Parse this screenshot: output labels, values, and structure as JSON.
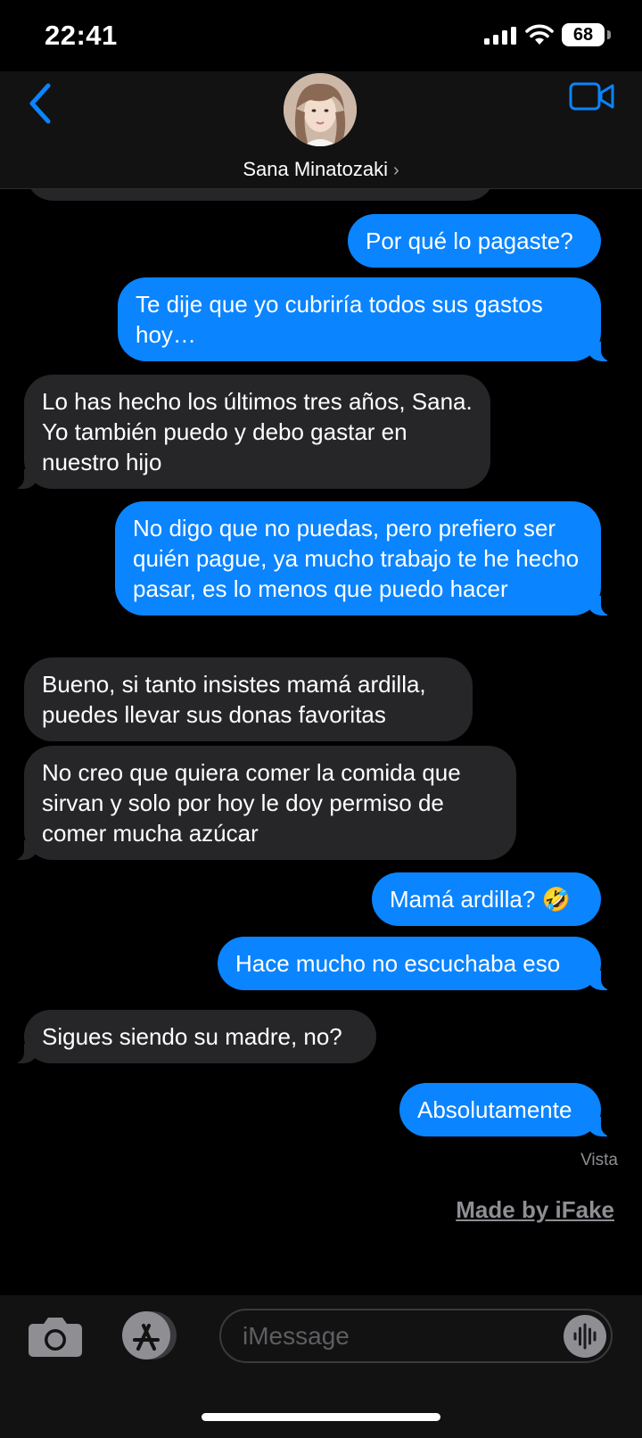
{
  "status_bar": {
    "time": "22:41",
    "battery": "68"
  },
  "header": {
    "contact_name": "Sana Minatozaki"
  },
  "messages": [
    {
      "dir": "out",
      "text": "Por qué lo pagaste?"
    },
    {
      "dir": "out",
      "text": "Te dije que yo cubriría todos sus gastos hoy…"
    },
    {
      "dir": "in",
      "text": "Lo has hecho los últimos tres años, Sana. Yo también puedo y debo gastar en nuestro hijo"
    },
    {
      "dir": "out",
      "text": "No digo que no puedas, pero prefiero ser quién pague, ya mucho trabajo te he hecho pasar, es lo menos que puedo hacer"
    },
    {
      "dir": "in",
      "text": "Bueno, si tanto insistes mamá ardilla, puedes llevar sus donas favoritas"
    },
    {
      "dir": "in",
      "text": "No creo que quiera comer la comida que sirvan y solo por hoy le doy permiso de comer mucha azúcar"
    },
    {
      "dir": "out",
      "text": "Mamá ardilla? 🤣"
    },
    {
      "dir": "out",
      "text": "Hace mucho no escuchaba eso"
    },
    {
      "dir": "in",
      "text": "Sigues siendo su madre, no?"
    },
    {
      "dir": "out",
      "text": "Absolutamente"
    }
  ],
  "read_receipt": "Vista",
  "watermark": "Made by iFake",
  "composer": {
    "placeholder": "iMessage"
  },
  "colors": {
    "outgoing": "#0a84ff",
    "incoming": "#262628",
    "accent": "#0a84ff"
  }
}
